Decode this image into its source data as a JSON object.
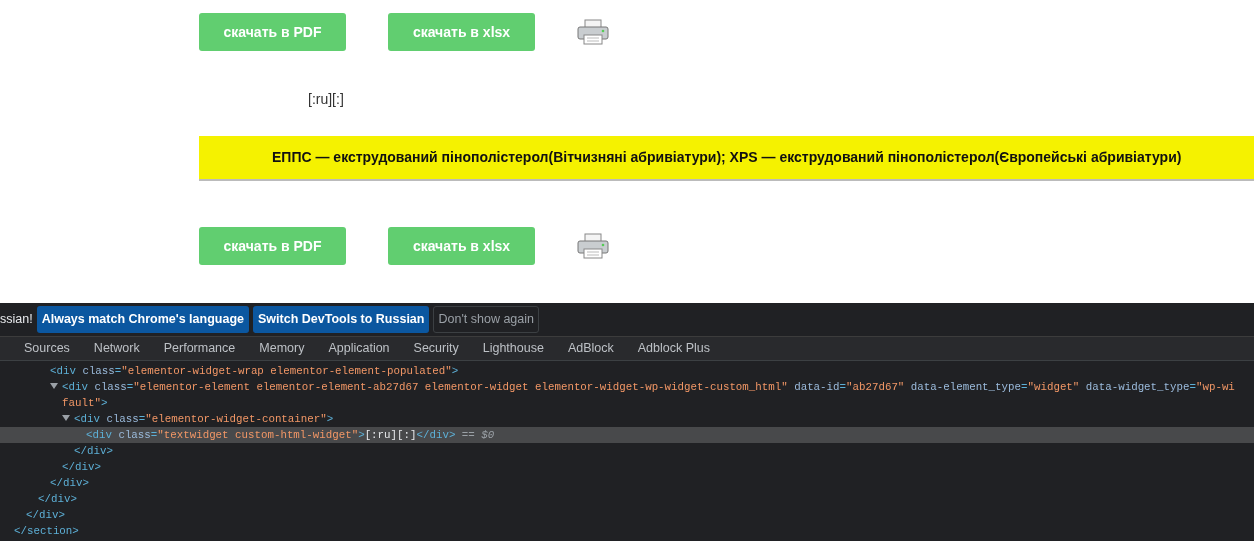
{
  "page": {
    "top_buttons": [
      "скачать в PDF",
      "скачать в xlsx"
    ],
    "shortcode_text": "[:ru][:]",
    "notice": "ЕППС — екструдований пінополістерол(Вітчизняні абривіатури); XPS — екструдований пінополістерол(Європейські абривіатури)",
    "bottom_buttons": [
      "скачать в PDF",
      "скачать в xlsx"
    ]
  },
  "devtools": {
    "infobar": {
      "message": "ssian!",
      "buttons": [
        {
          "label": "Always match Chrome's language",
          "kind": "primary"
        },
        {
          "label": "Switch DevTools to Russian",
          "kind": "primary"
        },
        {
          "label": "Don't show again",
          "kind": "plain"
        }
      ]
    },
    "tabs": [
      {
        "label": "Sources",
        "selected": false
      },
      {
        "label": "Network",
        "selected": false
      },
      {
        "label": "Performance",
        "selected": false
      },
      {
        "label": "Memory",
        "selected": false
      },
      {
        "label": "Application",
        "selected": false
      },
      {
        "label": "Security",
        "selected": false
      },
      {
        "label": "Lighthouse",
        "selected": false
      },
      {
        "label": "AdBlock",
        "selected": false
      },
      {
        "label": "Adblock Plus",
        "selected": false
      }
    ],
    "dom_tree": [
      {
        "close": [
          {
            "kind": "tag",
            "text": "</section>"
          }
        ],
        "children": [
          {
            "close": [
              {
                "kind": "tag",
                "text": "</div>"
              }
            ],
            "children": [
              {
                "close": [
                  {
                    "kind": "tag",
                    "text": "</div>"
                  }
                ],
                "children": [
                  {
                    "open": [
                      [
                        {
                          "kind": "tag",
                          "text": "<div"
                        },
                        {
                          "kind": "attr",
                          "text": " class"
                        },
                        {
                          "kind": "tag",
                          "text": "="
                        },
                        {
                          "kind": "value",
                          "text": "\"elementor-widget-wrap elementor-element-populated\""
                        },
                        {
                          "kind": "tag",
                          "text": ">"
                        }
                      ]
                    ],
                    "close": [
                      {
                        "kind": "tag",
                        "text": "</div>"
                      }
                    ],
                    "children": [
                      {
                        "expanded": true,
                        "selected": false,
                        "open": [
                          [
                            {
                              "kind": "tag",
                              "text": "<div"
                            },
                            {
                              "kind": "attr",
                              "text": " class"
                            },
                            {
                              "kind": "tag",
                              "text": "="
                            },
                            {
                              "kind": "value",
                              "text": "\"elementor-element elementor-element-ab27d67 elementor-widget elementor-widget-wp-widget-custom_html\""
                            },
                            {
                              "kind": "attr",
                              "text": " data-id"
                            },
                            {
                              "kind": "tag",
                              "text": "="
                            },
                            {
                              "kind": "value",
                              "text": "\"ab27d67\""
                            },
                            {
                              "kind": "attr",
                              "text": " data-element_type"
                            },
                            {
                              "kind": "tag",
                              "text": "="
                            },
                            {
                              "kind": "value",
                              "text": "\"widget\""
                            },
                            {
                              "kind": "attr",
                              "text": " data-widget_type"
                            },
                            {
                              "kind": "tag",
                              "text": "="
                            },
                            {
                              "kind": "value",
                              "text": "\"wp-wi"
                            }
                          ],
                          [
                            {
                              "kind": "value",
                              "text": "fault\""
                            },
                            {
                              "kind": "tag",
                              "text": ">"
                            }
                          ]
                        ],
                        "close": [
                          {
                            "kind": "tag",
                            "text": "</div>"
                          }
                        ],
                        "children": [
                          {
                            "expanded": true,
                            "selected": false,
                            "open": [
                              [
                                {
                                  "kind": "tag",
                                  "text": "<div"
                                },
                                {
                                  "kind": "attr",
                                  "text": " class"
                                },
                                {
                                  "kind": "tag",
                                  "text": "="
                                },
                                {
                                  "kind": "value",
                                  "text": "\"elementor-widget-container\""
                                },
                                {
                                  "kind": "tag",
                                  "text": ">"
                                }
                              ]
                            ],
                            "close": [
                              {
                                "kind": "tag",
                                "text": "</div>"
                              }
                            ],
                            "children": [
                              {
                                "selected": true,
                                "open": [
                                  [
                                    {
                                      "kind": "tag",
                                      "text": "<div"
                                    },
                                    {
                                      "kind": "attr",
                                      "text": " class"
                                    },
                                    {
                                      "kind": "tag",
                                      "text": "="
                                    },
                                    {
                                      "kind": "value",
                                      "text": "\"textwidget custom-html-widget\""
                                    },
                                    {
                                      "kind": "tag",
                                      "text": ">"
                                    },
                                    {
                                      "kind": "text",
                                      "text": "[:ru][:]"
                                    },
                                    {
                                      "kind": "tag",
                                      "text": "</div>"
                                    },
                                    {
                                      "kind": "marker",
                                      "text": " == $0"
                                    }
                                  ]
                                ]
                              }
                            ]
                          }
                        ]
                      }
                    ]
                  }
                ]
              }
            ]
          }
        ]
      }
    ]
  }
}
